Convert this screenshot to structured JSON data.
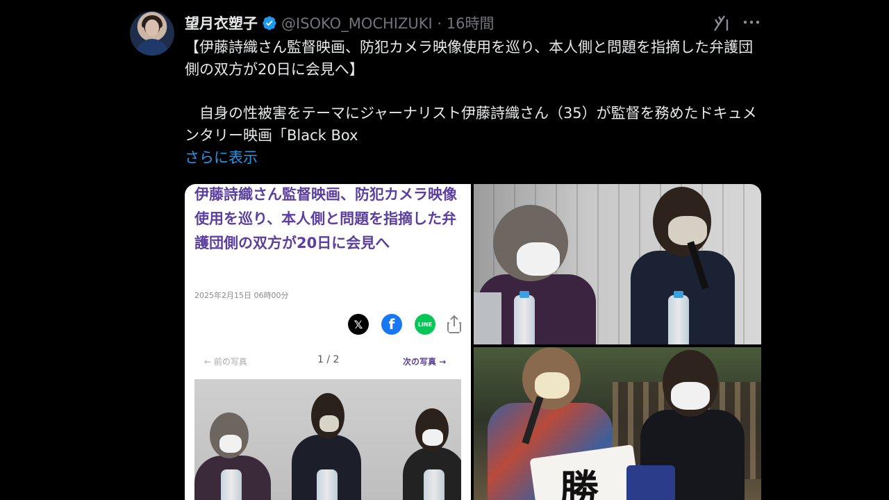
{
  "post": {
    "display_name": "望月衣塑子",
    "handle_meta": "@ISOKO_MOCHIZUKI · 16時間",
    "text_line1": "【伊藤詩織さん監督映画、防犯カメラ映像使用を巡り、本人側と問題を指摘した弁護団側の双方が20日に会見へ】",
    "text_line2": "　自身の性被害をテーマにジャーナリスト伊藤詩織さん（35）が監督を務めたドキュメンタリー映画「Black Box",
    "show_more": "さらに表示",
    "icons": [
      "verified-badge-icon",
      "grok-icon",
      "more-icon"
    ],
    "accent_color": "#1d9bf0"
  },
  "article": {
    "title": "伊藤詩織さん監督映画、防犯カメラ映像使用を巡り、本人側と問題を指摘した弁護団側の双方が20日に会見へ",
    "date": "2025年2月15日 06時00分",
    "prev_label": "前の写真",
    "counter": "1 / 2",
    "next_label": "次の写真",
    "share_icons": [
      "x-icon",
      "facebook-icon",
      "line-icon",
      "share-icon"
    ],
    "share_x": "𝕏",
    "share_fb": "f",
    "share_line": "LINE",
    "title_color": "#5b3ea0"
  },
  "photos": {
    "sign_text": "勝"
  }
}
